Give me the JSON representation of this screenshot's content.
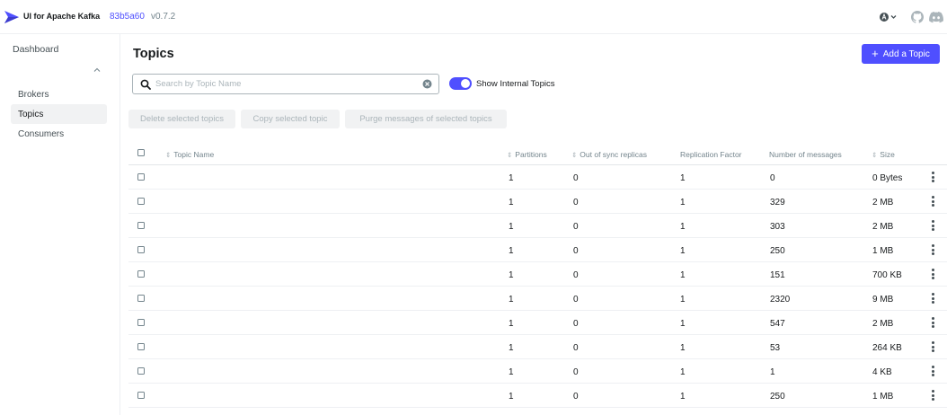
{
  "header": {
    "app_title": "UI for Apache Kafka",
    "version_hash": "83b5a60",
    "version": "v0.7.2"
  },
  "sidebar": {
    "dashboard_label": "Dashboard",
    "cluster_name": "",
    "items": [
      {
        "label": "Brokers",
        "active": false
      },
      {
        "label": "Topics",
        "active": true
      },
      {
        "label": "Consumers",
        "active": false
      }
    ]
  },
  "main": {
    "title": "Topics",
    "add_topic_label": "Add a Topic",
    "search": {
      "placeholder": "Search by Topic Name",
      "value": ""
    },
    "internal_toggle": {
      "label": "Show Internal Topics",
      "checked": true
    },
    "actions": {
      "delete": "Delete selected topics",
      "copy": "Copy selected topic",
      "purge": "Purge messages of selected topics"
    }
  },
  "table": {
    "columns": {
      "topic_name": "Topic Name",
      "partitions": "Partitions",
      "out_of_sync": "Out of sync replicas",
      "replication": "Replication Factor",
      "messages": "Number of messages",
      "size": "Size"
    },
    "rows": [
      {
        "name": "",
        "partitions": "1",
        "out_of_sync": "0",
        "replication": "1",
        "messages": "0",
        "size": "0 Bytes"
      },
      {
        "name": "",
        "partitions": "1",
        "out_of_sync": "0",
        "replication": "1",
        "messages": "329",
        "size": "2 MB"
      },
      {
        "name": "",
        "partitions": "1",
        "out_of_sync": "0",
        "replication": "1",
        "messages": "303",
        "size": "2 MB"
      },
      {
        "name": "",
        "partitions": "1",
        "out_of_sync": "0",
        "replication": "1",
        "messages": "250",
        "size": "1 MB"
      },
      {
        "name": "",
        "partitions": "1",
        "out_of_sync": "0",
        "replication": "1",
        "messages": "151",
        "size": "700 KB"
      },
      {
        "name": "",
        "partitions": "1",
        "out_of_sync": "0",
        "replication": "1",
        "messages": "2320",
        "size": "9 MB"
      },
      {
        "name": "",
        "partitions": "1",
        "out_of_sync": "0",
        "replication": "1",
        "messages": "547",
        "size": "2 MB"
      },
      {
        "name": "",
        "partitions": "1",
        "out_of_sync": "0",
        "replication": "1",
        "messages": "53",
        "size": "264 KB"
      },
      {
        "name": "",
        "partitions": "1",
        "out_of_sync": "0",
        "replication": "1",
        "messages": "1",
        "size": "4 KB"
      },
      {
        "name": "",
        "partitions": "1",
        "out_of_sync": "0",
        "replication": "1",
        "messages": "250",
        "size": "1 MB"
      }
    ]
  },
  "colors": {
    "accent": "#4f4fff",
    "text": "#171a1c",
    "muted": "#73848c",
    "disabled": "#abb5ba",
    "border": "#eef0f3"
  },
  "icons": [
    "kafka-logo-icon",
    "theme-icon",
    "chevron-down-icon",
    "github-icon",
    "discord-icon",
    "search-icon",
    "clear-icon",
    "plus-icon",
    "sort-icon",
    "kebab-menu-icon"
  ]
}
